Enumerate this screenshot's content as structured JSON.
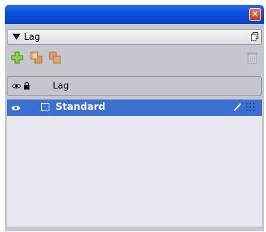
{
  "window": {
    "close_glyph": "×"
  },
  "panel": {
    "title": "Lag"
  },
  "toolbar": {
    "icons": [
      "new-layer-icon",
      "duplicate-layer-icon",
      "merge-layer-icon",
      "trash-icon"
    ]
  },
  "layers": [
    {
      "name": "Lag",
      "visible": true,
      "locked": true
    },
    {
      "name": "Standard",
      "visible": true,
      "locked": false,
      "selected": true
    }
  ],
  "colors": {
    "titlebar": "#0b4fd8",
    "selected_row": "#3c6fd0",
    "panel_bg": "#c5c7cf",
    "list_bg": "#e8e9f0"
  }
}
